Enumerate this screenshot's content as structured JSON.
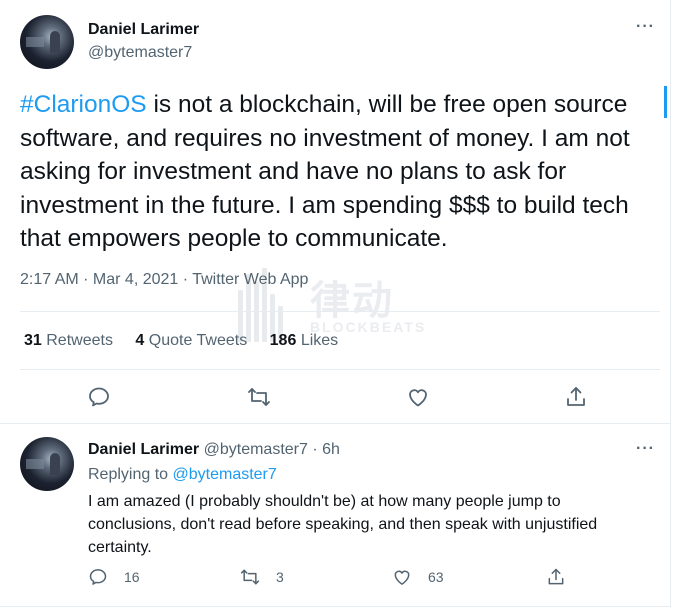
{
  "tweet": {
    "author_name": "Daniel Larimer",
    "author_handle": "@bytemaster7",
    "more_icon": "more-horizontal-icon",
    "text_hashtag": "#ClarionOS",
    "text_body": " is not a blockchain, will be free open source software, and requires no investment of money. I am not asking for investment and have no plans to ask for investment in the future. I am spending $$$ to build tech that empowers people to communicate.",
    "meta": "2:17 AM · Mar 4, 2021 · Twitter Web App",
    "stats": {
      "retweets_count": "31",
      "retweets_label": "Retweets",
      "quote_count": "4",
      "quote_label": "Quote Tweets",
      "likes_count": "186",
      "likes_label": "Likes"
    },
    "actions": [
      "reply-icon",
      "retweet-icon",
      "like-icon",
      "share-icon"
    ]
  },
  "reply": {
    "author_name": "Daniel Larimer",
    "author_handle": "@bytemaster7",
    "separator": " · ",
    "time": "6h",
    "replying_prefix": "Replying to ",
    "replying_mention": "@bytemaster7",
    "text": "I am amazed (I probably shouldn't be) at how many people jump to conclusions, don't read before speaking, and then speak with unjustified certainty.",
    "reply_count": "16",
    "retweet_count": "3",
    "like_count": "63"
  },
  "watermark": {
    "cn": "律动",
    "en": "BLOCKBEATS"
  },
  "colors": {
    "accent": "#1d9bf0",
    "text": "#0f1419",
    "muted": "#536471",
    "divider": "#e6ecf0"
  }
}
